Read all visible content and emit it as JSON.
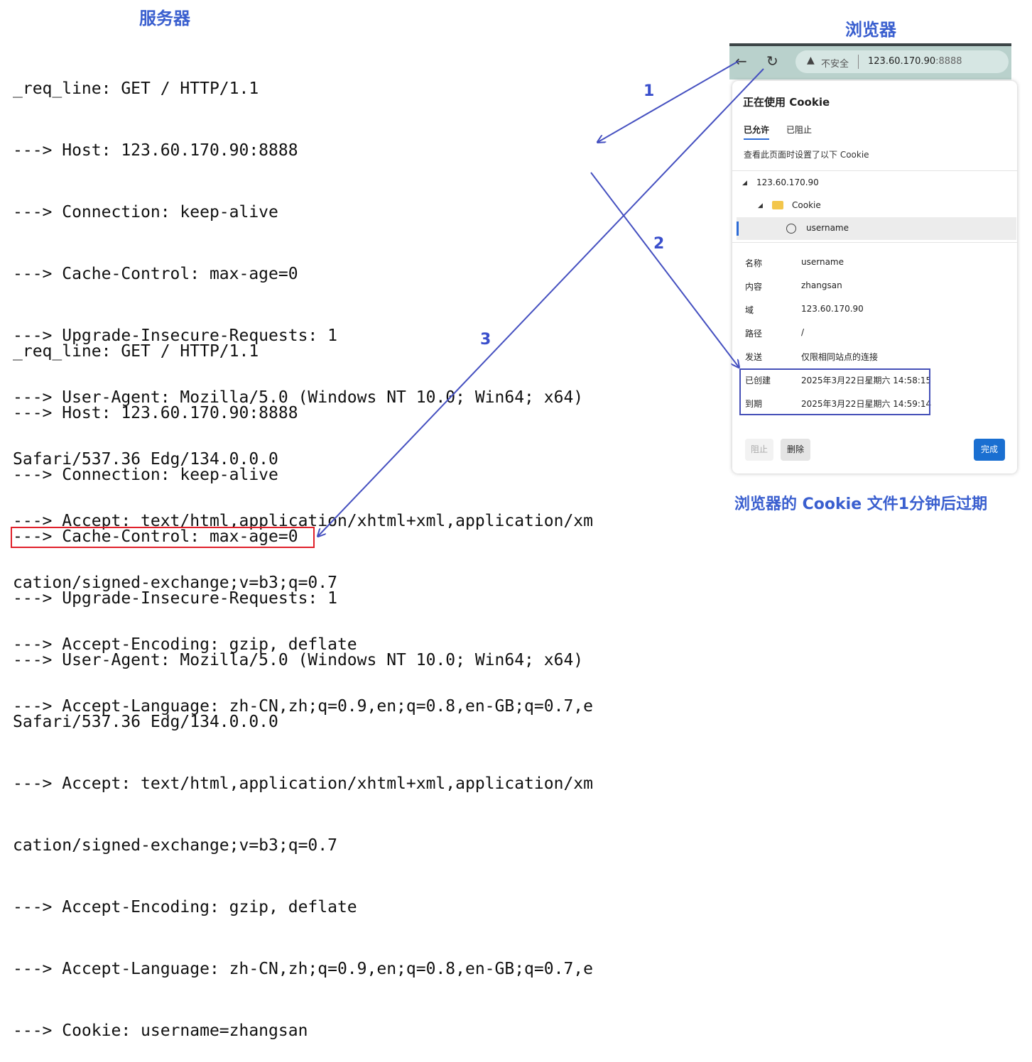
{
  "titles": {
    "server": "服务器",
    "browser": "浏览器",
    "caption": "浏览器的 Cookie 文件1分钟后过期"
  },
  "server_log": {
    "request1": [
      "_req_line: GET / HTTP/1.1",
      "---> Host: 123.60.170.90:8888",
      "---> Connection: keep-alive",
      "---> Cache-Control: max-age=0",
      "---> Upgrade-Insecure-Requests: 1",
      "---> User-Agent: Mozilla/5.0 (Windows NT 10.0; Win64; x64) ",
      "Safari/537.36 Edg/134.0.0.0",
      "---> Accept: text/html,application/xhtml+xml,application/xm",
      "cation/signed-exchange;v=b3;q=0.7",
      "---> Accept-Encoding: gzip, deflate",
      "---> Accept-Language: zh-CN,zh;q=0.9,en;q=0.8,en-GB;q=0.7,e"
    ],
    "request2": [
      "_req_line: GET / HTTP/1.1",
      "---> Host: 123.60.170.90:8888",
      "---> Connection: keep-alive",
      "---> Cache-Control: max-age=0",
      "---> Upgrade-Insecure-Requests: 1",
      "---> User-Agent: Mozilla/5.0 (Windows NT 10.0; Win64; x64) ",
      "Safari/537.36 Edg/134.0.0.0",
      "---> Accept: text/html,application/xhtml+xml,application/xm",
      "cation/signed-exchange;v=b3;q=0.7",
      "---> Accept-Encoding: gzip, deflate",
      "---> Accept-Language: zh-CN,zh;q=0.9,en;q=0.8,en-GB;q=0.7,e",
      "---> Cookie: username=zhangsan"
    ]
  },
  "browser": {
    "toolbar": {
      "back_icon": "back-arrow-icon",
      "reload_icon": "reload-icon",
      "warning_icon": "warning-icon",
      "insecure_label": "不安全",
      "url_host": "123.60.170.90",
      "url_port": ":8888"
    },
    "cookie_panel": {
      "title": "正在使用 Cookie",
      "tabs": [
        "已允许",
        "已阻止"
      ],
      "description": "查看此页面时设置了以下 Cookie",
      "tree": {
        "site": "123.60.170.90",
        "folder": "Cookie",
        "item": "username"
      },
      "details": [
        {
          "label": "名称",
          "value": "username"
        },
        {
          "label": "内容",
          "value": "zhangsan"
        },
        {
          "label": "域",
          "value": "123.60.170.90"
        },
        {
          "label": "路径",
          "value": "/"
        },
        {
          "label": "发送",
          "value": "仅限相同站点的连接"
        },
        {
          "label": "已创建",
          "value": "2025年3月22日星期六 14:58:15"
        },
        {
          "label": "到期",
          "value": "2025年3月22日星期六 14:59:14"
        }
      ],
      "buttons": {
        "block": "阻止",
        "delete": "删除",
        "done": "完成"
      }
    }
  },
  "arrow_labels": [
    "1",
    "2",
    "3"
  ],
  "colors": {
    "title": "#3a5fcf",
    "arrow": "#4550c0",
    "highlight_red": "#e0202a",
    "primary_button": "#1a6fd1"
  }
}
